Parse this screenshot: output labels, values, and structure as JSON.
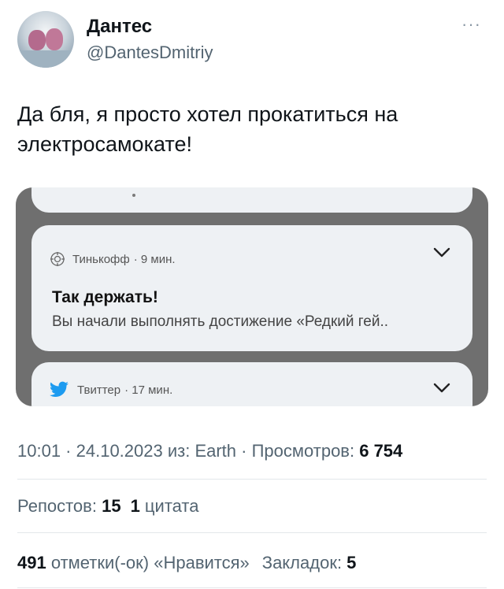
{
  "author": {
    "name": "Дантес",
    "handle": "@DantesDmitriy"
  },
  "more_label": "···",
  "tweet": {
    "text": "Да бля, я просто хотел прокатиться на электросамокате!"
  },
  "screenshot": {
    "notification1": {
      "app": "Тинькофф",
      "time": "· 9 мин.",
      "title": "Так держать!",
      "body": "Вы начали выполнять достижение «Редкий гей.."
    },
    "notification2": {
      "app": "Твиттер",
      "time": "· 17 мин."
    }
  },
  "meta": {
    "time": "10:01",
    "sep1": " · ",
    "date": "24.10.2023",
    "source": " из: Earth",
    "sep2": " · ",
    "views_label": "Просмотров: ",
    "views_value": "6 754"
  },
  "stats": {
    "reposts_label": "Репостов: ",
    "reposts_value": "15",
    "quotes_value": "1",
    "quotes_label": " цитата",
    "likes_value": "491",
    "likes_label": " отметки(-ок) «Нравится»",
    "bookmarks_label": "Закладок: ",
    "bookmarks_value": "5"
  },
  "colors": {
    "secondary_text": "#536471",
    "primary_text": "#0f1419",
    "twitter_blue": "#1d9bf0"
  }
}
